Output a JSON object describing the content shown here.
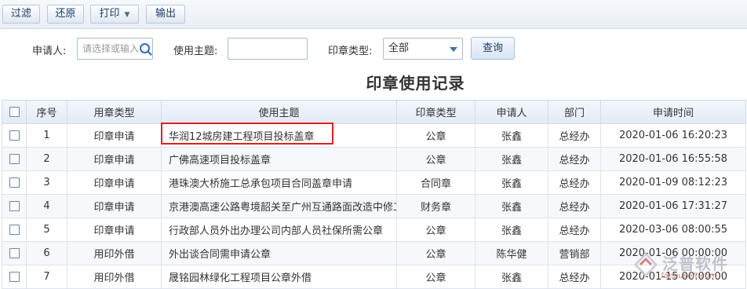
{
  "toolbar": {
    "filter_label": "过滤",
    "reset_label": "还原",
    "print_label": "打印",
    "export_label": "输出"
  },
  "filters": {
    "applicant_label": "申请人:",
    "applicant_placeholder": "请选择或输入",
    "topic_label": "使用主题:",
    "topic_value": "",
    "seal_type_label": "印章类型:",
    "seal_type_value": "全部",
    "query_label": "查询"
  },
  "report_title": "印章使用记录",
  "table": {
    "headers": [
      "序号",
      "用章类型",
      "使用主题",
      "印章类型",
      "申请人",
      "部门",
      "申请时间"
    ],
    "rows": [
      {
        "no": "1",
        "use_type": "印章申请",
        "topic": "华润12城房建工程项目投标盖章",
        "seal": "公章",
        "applicant": "张鑫",
        "dept": "总经办",
        "time": "2020-01-06 16:20:23"
      },
      {
        "no": "2",
        "use_type": "印章申请",
        "topic": "广佛高速项目投标盖章",
        "seal": "公章",
        "applicant": "张鑫",
        "dept": "总经办",
        "time": "2020-01-06 16:55:58"
      },
      {
        "no": "3",
        "use_type": "印章申请",
        "topic": "港珠澳大桥施工总承包项目合同盖章申请",
        "seal": "合同章",
        "applicant": "张鑫",
        "dept": "总经办",
        "time": "2020-01-09 08:12:23"
      },
      {
        "no": "4",
        "use_type": "印章申请",
        "topic": "京港澳高速公路粤境韶关至广州互通路面改造中修工程",
        "seal": "财务章",
        "applicant": "张鑫",
        "dept": "总经办",
        "time": "2020-01-06 17:31:27"
      },
      {
        "no": "5",
        "use_type": "印章申请",
        "topic": "行政部人员外出办理公司内部人员社保所需公章",
        "seal": "公章",
        "applicant": "张鑫",
        "dept": "总经办",
        "time": "2020-03-06 08:00:55"
      },
      {
        "no": "6",
        "use_type": "用印外借",
        "topic": "外出谈合同需申请公章",
        "seal": "公章",
        "applicant": "陈华健",
        "dept": "营销部",
        "time": "2020-01-06 00:00:00"
      },
      {
        "no": "7",
        "use_type": "用印外借",
        "topic": "晟铭园林绿化工程项目公章外借",
        "seal": "公章",
        "applicant": "张鑫",
        "dept": "总经办",
        "time": "2020-01-15 00:00:00"
      }
    ]
  },
  "watermark": {
    "brand": "泛普软件",
    "url": "fanpusoft.com"
  },
  "colors": {
    "link": "#1c5fae",
    "highlight": "#e02020"
  }
}
